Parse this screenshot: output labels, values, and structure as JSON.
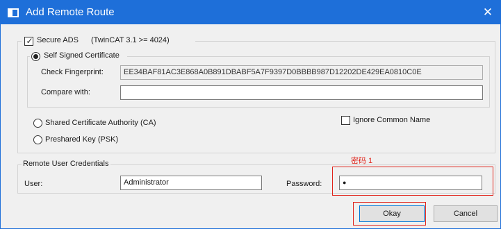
{
  "window": {
    "title": "Add Remote Route",
    "close_glyph": "✕"
  },
  "secure_ads": {
    "label": "Secure ADS",
    "version_note": "(TwinCAT 3.1 >= 4024)",
    "checked": "✓"
  },
  "self_signed": {
    "label": "Self Signed Certificate",
    "fingerprint_label": "Check Fingerprint:",
    "fingerprint_value": "EE34BAF81AC3E868A0B891DBABF5A7F9397D0BBBB987D12202DE429EA0810C0E",
    "compare_label": "Compare with:",
    "compare_value": ""
  },
  "shared_ca": {
    "label": "Shared Certificate Authority (CA)"
  },
  "ignore_common_name": {
    "label": "Ignore Common Name"
  },
  "psk": {
    "label": "Preshared Key (PSK)"
  },
  "credentials": {
    "group_label": "Remote User Credentials",
    "user_label": "User:",
    "user_value": "Administrator",
    "password_label": "Password:",
    "password_value": "●",
    "annotation": "密码 1"
  },
  "buttons": {
    "okay": "Okay",
    "cancel": "Cancel"
  },
  "colors": {
    "title_bar": "#1e6fd9",
    "annotation_red": "#e0241b"
  },
  "icons": {
    "app": "window-app-icon",
    "close": "close-icon"
  }
}
